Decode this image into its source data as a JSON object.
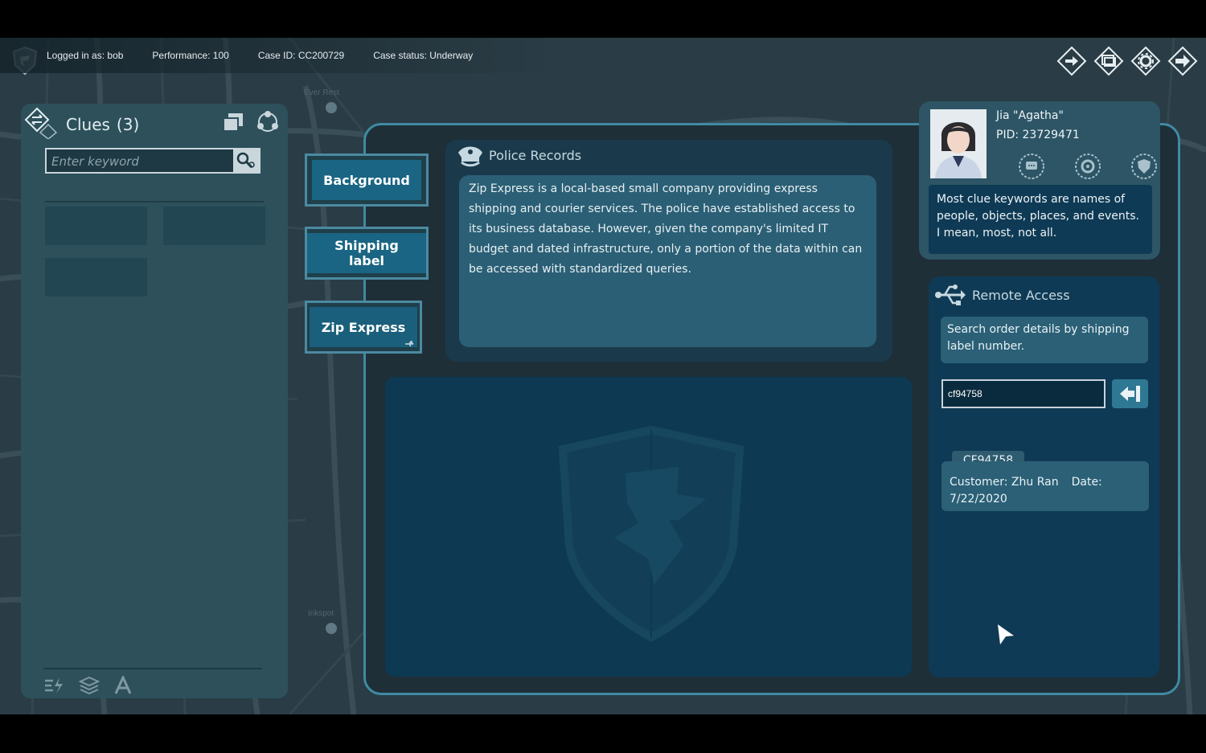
{
  "topbar": {
    "logged_in": "Logged in as: bob",
    "performance": "Performance: 100",
    "case_id": "Case ID: CC200729",
    "case_status": "Case status: Underway"
  },
  "map_labels": [
    "Ever Rest",
    "Inkspot"
  ],
  "top_icons": [
    "login-diamond-icon",
    "window-diamond-icon",
    "settings-diamond-icon",
    "exit-diamond-icon"
  ],
  "clues": {
    "title": "Clues",
    "count": "(3)",
    "search_placeholder": "Enter keyword"
  },
  "tabs": [
    {
      "label": "Background"
    },
    {
      "label": "Shipping label"
    },
    {
      "label": "Zip Express"
    }
  ],
  "records": {
    "title": "Police Records",
    "text": "Zip Express is a local-based small company providing express shipping and courier services. The police have established access to its business database. However, given the company's limited IT budget and dated infrastructure, only a portion of the data within can be accessed with standardized queries."
  },
  "profile": {
    "name": "Jia \"Agatha\"",
    "pid": "PID: 23729471",
    "message": "Most clue keywords are names of people, objects, places, and events. I mean, most, not all."
  },
  "remote": {
    "title": "Remote Access",
    "hint": "Search order details by shipping label number.",
    "input_value": "cf94758",
    "result_tag": "CF94758",
    "result_customer": "Customer: Zhu Ran",
    "result_date_label": "Date:",
    "result_date": "7/22/2020"
  },
  "colors": {
    "accent": "#3f8aa3",
    "panel": "#2d505b",
    "dark_panel": "#0f3a55",
    "tab_fill": "#1a6583"
  }
}
